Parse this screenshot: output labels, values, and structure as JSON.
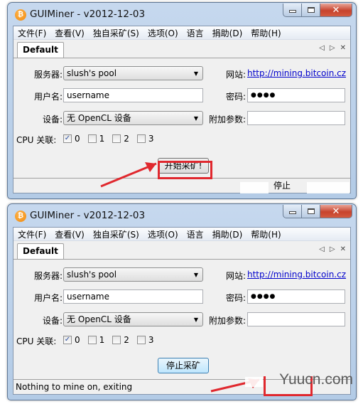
{
  "windows": [
    {
      "title": "GUIMiner - v2012-12-03",
      "menu": [
        "文件(F)",
        "查看(V)",
        "独自采矿(S)",
        "选项(O)",
        "语言",
        "捐助(D)",
        "帮助(H)"
      ],
      "tab": "Default",
      "tab_controls": [
        "◁",
        "▷",
        "✕"
      ],
      "form": {
        "server_label": "服务器:",
        "server_value": "slush's pool",
        "website_label": "网站:",
        "website_link": "http://mining.bitcoin.cz",
        "username_label": "用户名:",
        "username_value": "username",
        "password_label": "密码:",
        "password_value": "●●●●",
        "device_label": "设备:",
        "device_value": "无 OpenCL 设备",
        "extra_label": "附加参数:",
        "extra_value": "",
        "cpu_label": "CPU 关联:",
        "cpus": [
          {
            "label": "0",
            "checked": true
          },
          {
            "label": "1",
            "checked": false
          },
          {
            "label": "2",
            "checked": false
          },
          {
            "label": "3",
            "checked": false
          }
        ]
      },
      "action_button": "开始采矿!",
      "status_text": "",
      "status_right": "停止"
    },
    {
      "title": "GUIMiner - v2012-12-03",
      "menu": [
        "文件(F)",
        "查看(V)",
        "独自采矿(S)",
        "选项(O)",
        "语言",
        "捐助(D)",
        "帮助(H)"
      ],
      "tab": "Default",
      "tab_controls": [
        "◁",
        "▷",
        "✕"
      ],
      "form": {
        "server_label": "服务器:",
        "server_value": "slush's pool",
        "website_label": "网站:",
        "website_link": "http://mining.bitcoin.cz",
        "username_label": "用户名:",
        "username_value": "username",
        "password_label": "密码:",
        "password_value": "●●●●",
        "device_label": "设备:",
        "device_value": "无 OpenCL 设备",
        "extra_label": "附加参数:",
        "extra_value": "",
        "cpu_label": "CPU 关联:",
        "cpus": [
          {
            "label": "0",
            "checked": true
          },
          {
            "label": "1",
            "checked": false
          },
          {
            "label": "2",
            "checked": false
          },
          {
            "label": "3",
            "checked": false
          }
        ]
      },
      "action_button": "停止采矿",
      "status_text": "Nothing to mine on, exiting",
      "status_right": ""
    }
  ],
  "icons": {
    "app": "₿",
    "combo_arrow": "▼",
    "check": "✓",
    "close": "✕"
  },
  "annotation_color": "#e0282e",
  "watermark": "Yuucn.com"
}
